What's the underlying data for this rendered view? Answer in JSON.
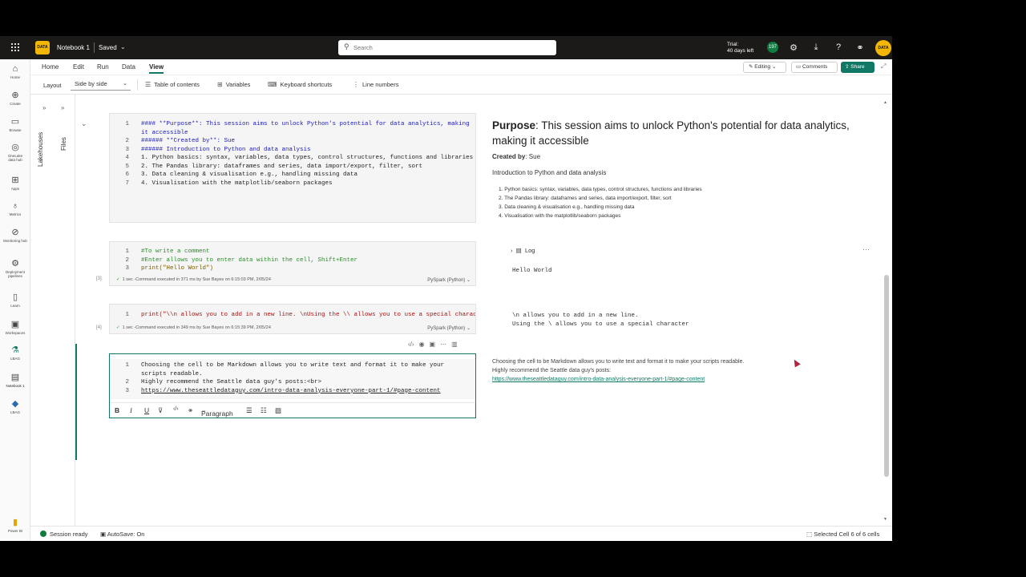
{
  "topbar": {
    "logo_text": "DATA",
    "notebook_title": "Notebook 1",
    "saved_label": "Saved",
    "search_placeholder": "Search",
    "trial_line1": "Trial:",
    "trial_line2": "40 days left",
    "notifications_count": "197",
    "avatar_text": "DATA"
  },
  "rail": [
    {
      "label": "Home",
      "icon": "home-icon",
      "glyph": "⌂"
    },
    {
      "label": "Create",
      "icon": "create-icon",
      "glyph": "⊕"
    },
    {
      "label": "Browse",
      "icon": "browse-icon",
      "glyph": "▭"
    },
    {
      "label": "OneLake data hub",
      "icon": "onelake-icon",
      "glyph": "◎"
    },
    {
      "label": "Apps",
      "icon": "apps-icon",
      "glyph": "⊞"
    },
    {
      "label": "Metrics",
      "icon": "metrics-icon",
      "glyph": "♁"
    },
    {
      "label": "Monitoring hub",
      "icon": "monitoring-icon",
      "glyph": "⊘"
    },
    {
      "label": "Deployment pipelines",
      "icon": "deployment-icon",
      "glyph": "⚙"
    },
    {
      "label": "Learn",
      "icon": "learn-icon",
      "glyph": "▯"
    },
    {
      "label": "Workspaces",
      "icon": "workspaces-icon",
      "glyph": "▣"
    },
    {
      "label": "LBAG",
      "icon": "lbag-icon",
      "glyph": "⚗"
    },
    {
      "label": "Notebook 1",
      "icon": "notebook-icon",
      "glyph": "▤"
    },
    {
      "label": "LBAG",
      "icon": "lbag-workspace-icon",
      "glyph": "◆"
    },
    {
      "label": "Power BI",
      "icon": "powerbi-icon",
      "glyph": "▮"
    }
  ],
  "menu": {
    "tabs": [
      "Home",
      "Edit",
      "Run",
      "Data",
      "View"
    ],
    "editing_label": "Editing",
    "comments_label": "Comments",
    "share_label": "Share"
  },
  "ribbon": {
    "layout_label": "Layout",
    "layout_value": "Side by side",
    "toc_label": "Table of contents",
    "variables_label": "Variables",
    "shortcuts_label": "Keyboard shortcuts",
    "line_numbers_label": "Line numbers"
  },
  "lakepanel": {
    "lakehouses_label": "Lakehouses",
    "files_label": "Files"
  },
  "cells": {
    "cell1": {
      "lines": [
        "#### **Purpose**: This session aims to unlock Python's potential for data analytics, making",
        "it accessible",
        "###### **Created by**: Sue",
        "###### Introduction to Python and data analysis",
        "1. Python basics: syntax, variables, data types, control structures, functions and libraries",
        "2. The Pandas library: dataframes and series, data import/export, filter, sort",
        "3. Data cleaning & visualisation e.g., handling missing data",
        "4. Visualisation with the matplotlib/seaborn packages"
      ],
      "line_numbers": [
        "1",
        "",
        "2",
        "3",
        "4",
        "5",
        "6",
        "7"
      ]
    },
    "cell2": {
      "lines": [
        "#To write a comment",
        "#Enter allows you to enter data within the cell, Shift+Enter",
        "print(\"Hello World\")"
      ],
      "line_numbers": [
        "1",
        "2",
        "3"
      ],
      "exec_number": "[3]",
      "exec_info": "1 sec -Command executed in 371 ms by Sue Bayes on 6:15:03 PM, 2/05/24",
      "kernel": "PySpark (Python)"
    },
    "cell3": {
      "lines": [
        "print(\"\\\\n allows you to add in a new line. \\nUsing the \\\\ allows you to use a special charact"
      ],
      "line_numbers": [
        "1"
      ],
      "exec_number": "[4]",
      "exec_info": "1 sec -Command executed in 349 ms by Sue Bayes on 6:15:39 PM, 2/05/24",
      "kernel": "PySpark (Python)"
    },
    "cell4": {
      "lines": [
        "Choosing the cell to be Markdown allows you to write text and format it to make your",
        "scripts readable.",
        "Highly recommend the Seattle data guy's posts:<br>",
        "https://www.theseattledataguy.com/intro-data-analysis-everyone-part-1/#page-content"
      ],
      "line_numbers": [
        "1",
        "",
        "2",
        "3"
      ],
      "paragraph_label": "Paragraph"
    }
  },
  "output": {
    "heading_bold": "Purpose",
    "heading_rest": ": This session aims to unlock Python's potential for data analytics, making it accessible",
    "created_bold": "Created by",
    "created_rest": ": Sue",
    "intro": "Introduction to Python and data analysis",
    "list": [
      "1. Python basics: syntax, variables, data types, control structures, functions and libraries",
      "2. The Pandas library: dataframes and series, data import/export, filter, sort",
      "3. Data cleaning & visualisation e.g., handling missing data",
      "4. Visualisation with the matplotlib/seaborn packages"
    ],
    "log_label": "Log",
    "hello": "Hello World",
    "newline_1": "\\n allows you to add in a new line.",
    "newline_2": "Using the \\ allows you to use a special character",
    "md_line1": "Choosing the cell to be Markdown allows you to write text and format it to make your scripts readable.",
    "md_line2": "Highly recommend the Seattle data guy's posts:",
    "md_link": "https://www.theseattledataguy.com/intro-data-analysis-everyone-part-1/#page-content"
  },
  "status": {
    "session": "Session ready",
    "autosave": "AutoSave: On",
    "selected": "Selected Cell 6 of 6 cells"
  },
  "colors": {
    "accent": "#117865",
    "topbar": "#1b1a19",
    "logo": "#f2b705"
  }
}
